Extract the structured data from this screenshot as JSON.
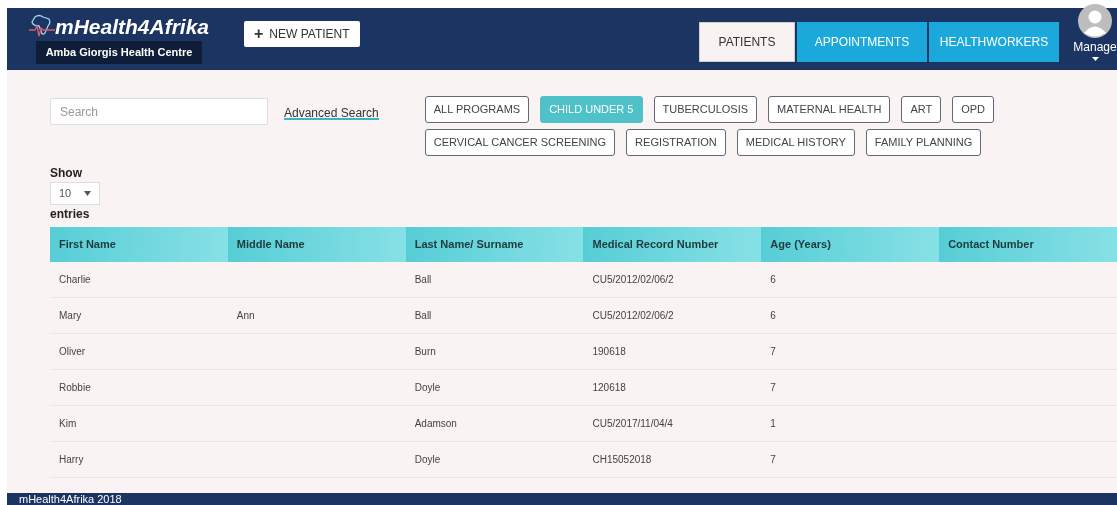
{
  "header": {
    "logo": "mHealth4Afrika",
    "facility": "Amba Giorgis Health Centre",
    "new_patient": {
      "icon": "+",
      "label": "NEW PATIENT"
    },
    "nav": [
      {
        "label": "PATIENTS",
        "selected": true
      },
      {
        "label": "APPOINTMENTS",
        "selected": false
      },
      {
        "label": "HEALTHWORKERS",
        "selected": false
      }
    ],
    "user_menu": {
      "label": "Manage"
    }
  },
  "search": {
    "placeholder": "Search",
    "advanced_link": "Advanced Search"
  },
  "programs": [
    [
      {
        "label": "ALL PROGRAMS",
        "selected": false
      },
      {
        "label": "CHILD UNDER 5",
        "selected": true
      },
      {
        "label": "TUBERCULOSIS",
        "selected": false
      },
      {
        "label": "MATERNAL HEALTH",
        "selected": false
      },
      {
        "label": "ART",
        "selected": false
      },
      {
        "label": "OPD",
        "selected": false
      }
    ],
    [
      {
        "label": "CERVICAL CANCER SCREENING",
        "selected": false
      },
      {
        "label": "REGISTRATION",
        "selected": false
      },
      {
        "label": "MEDICAL HISTORY",
        "selected": false
      },
      {
        "label": "FAMILY PLANNING",
        "selected": false
      }
    ]
  ],
  "entries": {
    "show_label": "Show",
    "value": "10",
    "entries_label": "entries"
  },
  "table": {
    "columns": [
      "First Name",
      "Middle Name",
      "Last Name/ Surname",
      "Medical Record Number",
      "Age (Years)",
      "Contact Number"
    ],
    "rows": [
      [
        "Charlie",
        "",
        "Ball",
        "CU5/2012/02/06/2",
        "6",
        ""
      ],
      [
        "Mary",
        "Ann",
        "Ball",
        "CU5/2012/02/06/2",
        "6",
        ""
      ],
      [
        "Oliver",
        "",
        "Burn",
        "190618",
        "7",
        ""
      ],
      [
        "Robbie",
        "",
        "Doyle",
        "120618",
        "7",
        ""
      ],
      [
        "Kim",
        "",
        "Adamson",
        "CU5/2017/11/04/4",
        "1",
        ""
      ],
      [
        "Harry",
        "",
        "Doyle",
        "CH15052018",
        "7",
        ""
      ]
    ]
  },
  "footer": "mHealth4Afrika 2018"
}
